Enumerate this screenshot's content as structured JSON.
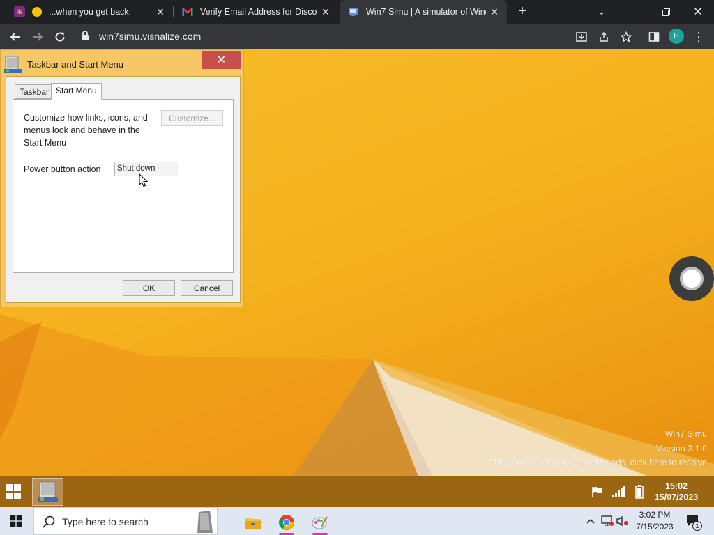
{
  "browser": {
    "tabs": [
      {
        "title": "...when you get back.",
        "favicon": "emoji-favicon-icon",
        "active": false
      },
      {
        "title": "Verify Email Address for Discord",
        "favicon": "gmail-icon",
        "active": false
      },
      {
        "title": "Win7 Simu | A simulator of Wind",
        "favicon": "win7simu-icon",
        "active": true
      }
    ],
    "url": "win7simu.visnalize.com",
    "profile_initial": "H"
  },
  "dialog": {
    "title": "Taskbar and Start Menu",
    "tabs": [
      "Taskbar",
      "Start Menu"
    ],
    "selected_tab": "Start Menu",
    "description": "Customize how links, icons, and menus look and behave in the Start Menu",
    "customize_label": "Customize...",
    "power_label": "Power button action",
    "power_value": "Shut down",
    "ok_label": "OK",
    "cancel_label": "Cancel"
  },
  "watermark": {
    "line1": "Win7 Simu",
    "line2": "Version 3.1.0",
    "line3": "This copy of Windows contains ads, click here to resolve"
  },
  "sim_taskbar": {
    "time": "15:02",
    "date": "15/07/2023"
  },
  "host_taskbar": {
    "search_placeholder": "Type here to search",
    "time": "3:02 PM",
    "date": "7/15/2023",
    "notification_count": "1"
  },
  "colors": {
    "desktop": "#f6b21e",
    "dialog_frame": "#f6c667",
    "close_button": "#c7504a",
    "sim_taskbar": "#9c6512",
    "host_taskbar": "#dfe7f3"
  }
}
